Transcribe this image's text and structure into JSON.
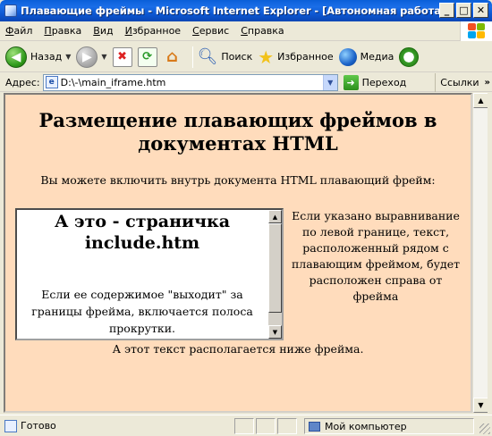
{
  "window": {
    "title": "Плавающие фреймы - Microsoft Internet Explorer - [Автономная работа]"
  },
  "menu": {
    "items": [
      {
        "label": "Файл",
        "accel": "Ф",
        "rest": "айл"
      },
      {
        "label": "Правка",
        "accel": "П",
        "rest": "равка"
      },
      {
        "label": "Вид",
        "accel": "В",
        "rest": "ид"
      },
      {
        "label": "Избранное",
        "accel": "И",
        "rest": "збранное"
      },
      {
        "label": "Сервис",
        "accel": "С",
        "rest": "ервис"
      },
      {
        "label": "Справка",
        "accel": "С",
        "rest": "правка"
      }
    ]
  },
  "toolbar": {
    "back_label": "Назад",
    "search_label": "Поиск",
    "favorites_label": "Избранное",
    "media_label": "Медиа"
  },
  "address": {
    "label": "Адрес:",
    "value": "D:\\-\\main_iframe.htm",
    "go_label": "Переход",
    "links_label": "Ссылки"
  },
  "page": {
    "heading": "Размещение плавающих фреймов в документах HTML",
    "intro": "Вы можете включить внутрь документа HTML плавающий фрейм:",
    "side_text": "Если указано выравнивание по левой границе, текст, расположенный рядом с плавающим фреймом, будет расположен справа от фрейма",
    "below_text": "А этот текст располагается ниже фрейма."
  },
  "iframe": {
    "heading": "А это - страничка include.htm",
    "body": "Если ее содержимое \"выходит\" за границы фрейма, включается полоса прокрутки."
  },
  "status": {
    "text": "Готово",
    "zone": "Мой компьютер"
  },
  "colors": {
    "page_bg": "#ffdcbc",
    "titlebar": "#0a5fd8"
  }
}
